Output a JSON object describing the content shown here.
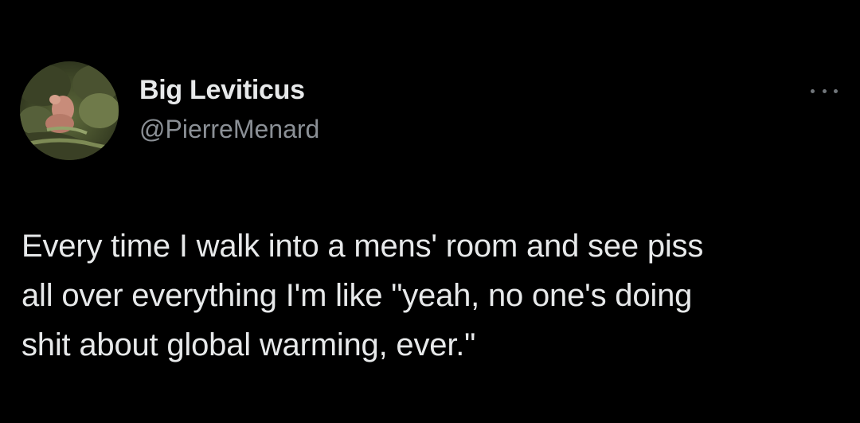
{
  "tweet": {
    "author": {
      "display_name": "Big Leviticus",
      "handle": "@PierreMenard",
      "avatar_icon": "avatar-photo"
    },
    "more_icon": "more-options-icon",
    "text": "Every time I walk into a mens' room and see piss\nall over everything I'm like \"yeah, no one's doing\nshit about global warming, ever.\""
  },
  "colors": {
    "background": "#000000",
    "primary_text": "#e7e9ea",
    "secondary_text": "#8b9096"
  }
}
